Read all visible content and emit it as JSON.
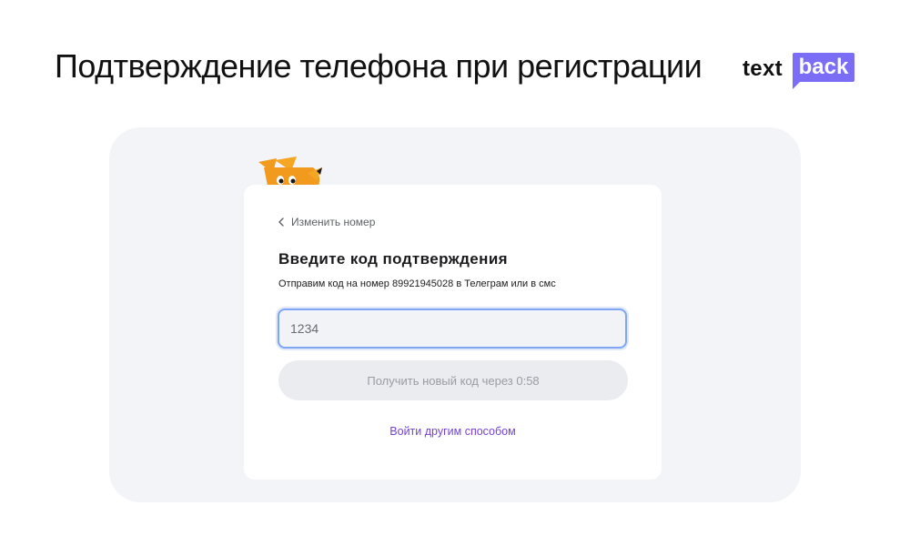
{
  "slide": {
    "title": "Подтверждение телефона при регистрации"
  },
  "logo": {
    "text": "text",
    "box": "back",
    "accent": "#7b6df5"
  },
  "card": {
    "back_label": "Изменить номер",
    "title": "Введите код подтверждения",
    "subtitle": "Отправим код на номер 89921945028 в Телеграм или в смс",
    "code_placeholder": "1234",
    "resend_label": "Получить новый код через 0:58",
    "alt_login_label": "Войти другим способом"
  },
  "icons": {
    "back": "chevron-left-icon",
    "mascot": "fox-icon"
  },
  "colors": {
    "link": "#7442d8",
    "input_focus": "#7fa6f2",
    "panel_bg": "#f3f4f8",
    "mascot": "#f29a1d"
  }
}
